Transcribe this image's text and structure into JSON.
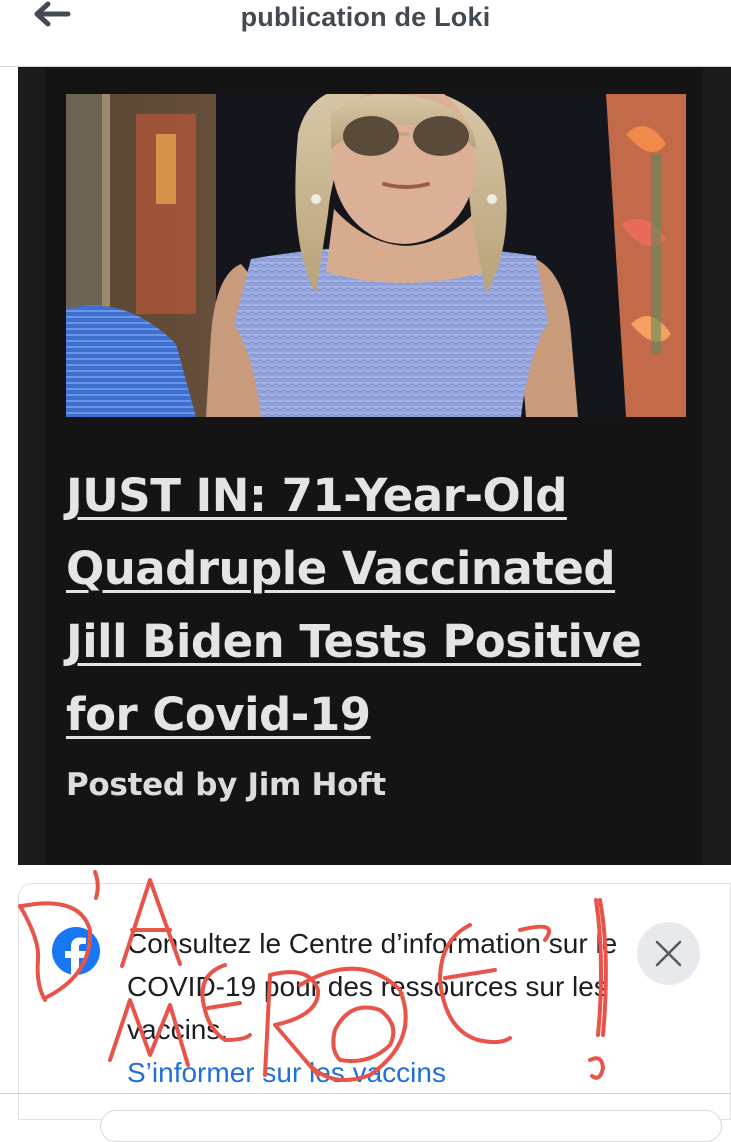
{
  "header": {
    "title": "publication de Loki",
    "back_icon": "arrow-left-icon"
  },
  "post": {
    "headline": "JUST IN: 71-Year-Old\nQuadruple Vaccinated\nJill Biden Tests Positive\nfor Covid-19",
    "byline": "Posted by Jim Hoft"
  },
  "covid_notice": {
    "logo_icon": "facebook-icon",
    "text": "Consultez le Centre d’information sur le COVID-19 pour des ressources sur les vaccins.",
    "link_label": "S’informer sur les vaccins",
    "close_icon": "close-icon"
  },
  "overlay": {
    "handwritten_text": "D'LA MERDE !"
  },
  "colors": {
    "title_text": "#444a52",
    "card_background": "#141414",
    "headline_text": "#e4e4e4",
    "link": "#216fdb",
    "facebook_blue": "#1877f2",
    "scribble_red": "#e8544a"
  }
}
